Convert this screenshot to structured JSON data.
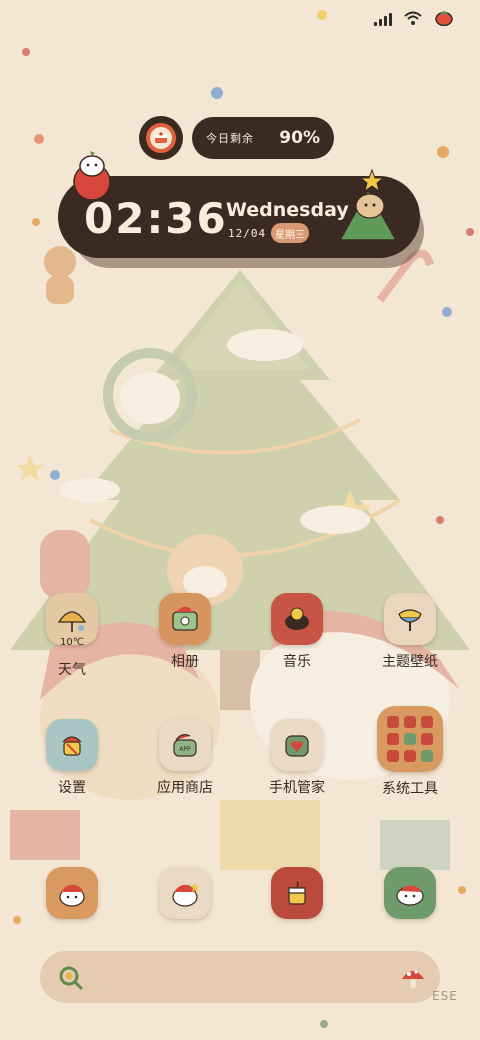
{
  "status_bar": {
    "icons": [
      "signal-icon",
      "wifi-icon",
      "tomato-icon"
    ]
  },
  "battery_widget": {
    "label": "今日剩余",
    "value": "90%",
    "level": 0.9
  },
  "clock_widget": {
    "time": "02:36",
    "day": "Wednesday",
    "date": "12/04",
    "weekday": "星期三"
  },
  "apps": [
    {
      "id": "weather",
      "label": "天气",
      "temperature": "10℃",
      "icon": "weather-icon",
      "color": "#e3c9a4"
    },
    {
      "id": "gallery",
      "label": "相册",
      "icon": "gallery-icon",
      "color": "#d7945e"
    },
    {
      "id": "music",
      "label": "音乐",
      "icon": "music-icon",
      "color": "#c85446"
    },
    {
      "id": "themes",
      "label": "主题壁纸",
      "icon": "theme-icon",
      "color": "#ead5be"
    },
    {
      "id": "settings",
      "label": "设置",
      "icon": "settings-icon",
      "color": "#a8c5c4"
    },
    {
      "id": "app-store",
      "label": "应用商店",
      "icon": "app-store-icon",
      "color": "#eadac5"
    },
    {
      "id": "phone-manager",
      "label": "手机管家",
      "icon": "phone-manager-icon",
      "color": "#ead9c3"
    },
    {
      "id": "system-tools",
      "label": "系统工具",
      "icon": "folder-icon",
      "color": "#d99a62"
    }
  ],
  "dock": [
    {
      "id": "dock-1",
      "icon": "dog-hat-icon",
      "color": "#d99a62"
    },
    {
      "id": "dock-2",
      "icon": "dog-hat-icon",
      "color": "#ead9c3"
    },
    {
      "id": "dock-3",
      "icon": "cake-icon",
      "color": "#b94a3c"
    },
    {
      "id": "dock-4",
      "icon": "dog-hat-icon",
      "color": "#6f9a6b"
    }
  ],
  "search_bar": {
    "left_icon": "search-icon",
    "right_icon": "mushroom-icon"
  },
  "corner_text": "ESE",
  "colors": {
    "widget_dark": "#3b2a22",
    "accent": "#d99a73",
    "background": "#f3e6d3"
  }
}
